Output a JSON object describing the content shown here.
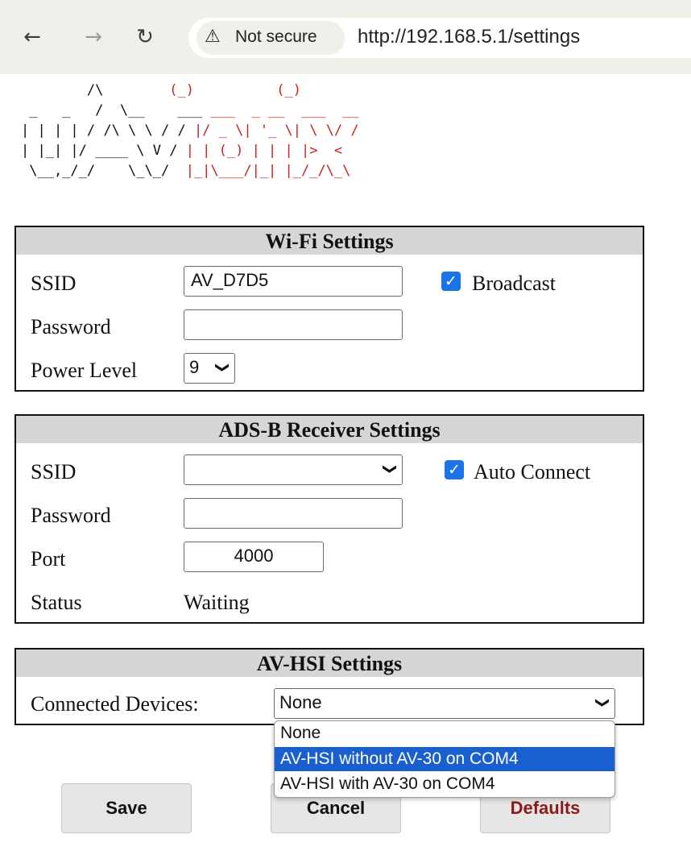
{
  "browser": {
    "back_icon": "arrow-left-icon",
    "forward_icon": "arrow-right-icon",
    "reload_icon": "reload-icon",
    "warning_icon": "warning-triangle-icon",
    "security_label": "Not secure",
    "url": "http://192.168.5.1/settings"
  },
  "logo": {
    "line1": {
      "left": "        /\\      ",
      "right": "  (_)          (_)"
    },
    "line2": {
      "left": " _   _   /  \\__    ___ ",
      "right": "___  _ __  ___  __"
    },
    "line3": {
      "left": "| | | | / /\\ \\ \\ / / ",
      "right": "|/ _ \\| '_ \\| \\ \\/ /"
    },
    "line4": {
      "left": "| |_| |/ ____ \\ V / ",
      "right": "| | (_) | | | |>  <"
    },
    "line5": {
      "left": " \\__,_/_/    \\_\\_/  ",
      "right": "|_|\\___/|_| |_/_/\\_\\"
    }
  },
  "wifi": {
    "title": "Wi-Fi Settings",
    "ssid_label": "SSID",
    "ssid_value": "AV_D7D5",
    "broadcast_label": "Broadcast",
    "broadcast_checked": true,
    "password_label": "Password",
    "password_value": "",
    "power_label": "Power Level",
    "power_value": "9"
  },
  "adsb": {
    "title": "ADS-B Receiver Settings",
    "ssid_label": "SSID",
    "ssid_value": "",
    "auto_connect_label": "Auto Connect",
    "auto_connect_checked": true,
    "password_label": "Password",
    "password_value": "",
    "port_label": "Port",
    "port_value": "4000",
    "status_label": "Status",
    "status_value": "Waiting"
  },
  "hsi": {
    "title": "AV-HSI Settings",
    "devices_label": "Connected Devices:",
    "devices_value": "None",
    "options": [
      "None",
      "AV-HSI without AV-30 on COM4",
      "AV-HSI with AV-30 on COM4"
    ],
    "highlighted_option": "AV-HSI without AV-30 on COM4"
  },
  "buttons": {
    "save": "Save",
    "cancel": "Cancel",
    "defaults": "Defaults"
  },
  "colors": {
    "logo_black": "#111111",
    "logo_red": "#cc2020",
    "checkbox": "#1a73e8",
    "option_highlight": "#1a5fd0",
    "defaults_text": "#8b1a1a"
  }
}
